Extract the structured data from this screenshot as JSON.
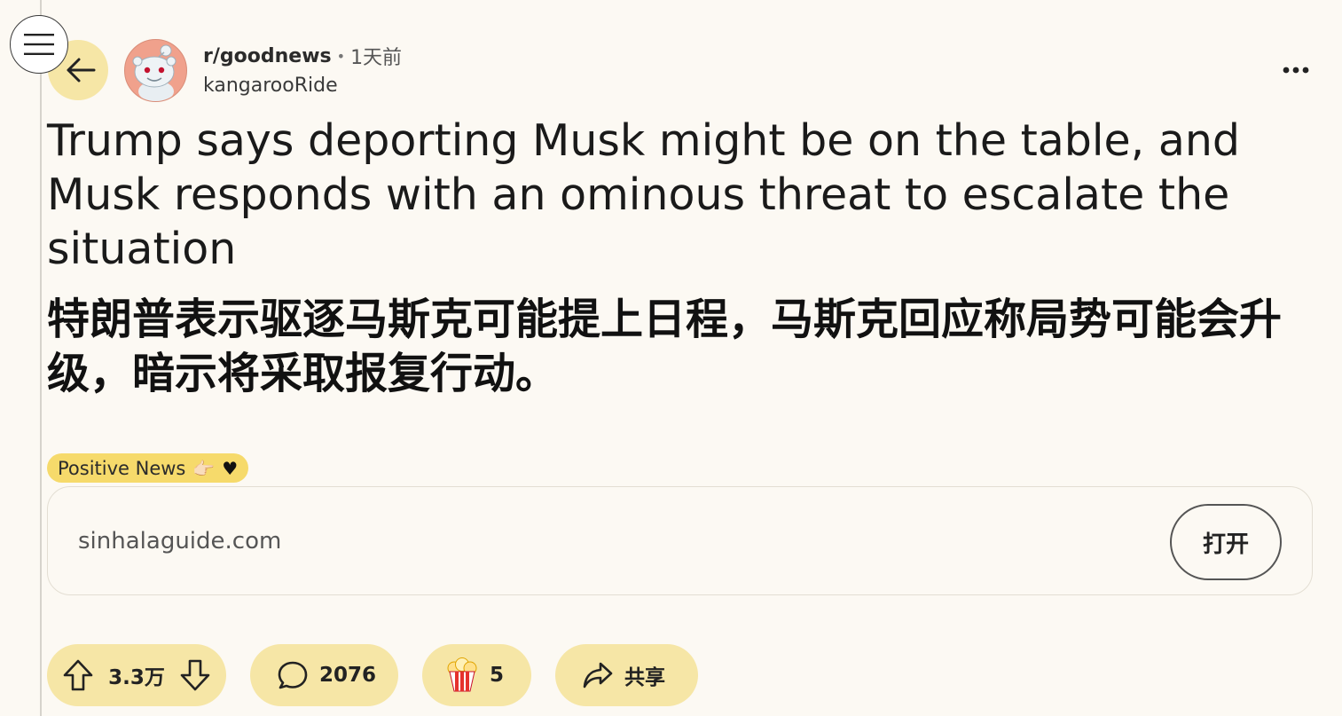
{
  "header": {
    "subreddit": "r/goodnews",
    "separator": "•",
    "time_ago": "1天前",
    "author": "kangarooRide"
  },
  "post": {
    "title_en": "Trump says deporting Musk might be on the table, and Musk responds with an ominous threat to escalate the situation",
    "title_zh": "特朗普表示驱逐马斯克可能提上日程，马斯克回应称局势可能会升级，暗示将采取报复行动。",
    "flair": {
      "text": "Positive News",
      "emoji": "👉🏻",
      "heart": "♥",
      "color": "#f6da6b"
    },
    "link": {
      "domain": "sinhalaguide.com",
      "open_label": "打开"
    }
  },
  "actions": {
    "votes": "3.3万",
    "comments": "2076",
    "awards": "5",
    "share_label": "共享"
  },
  "icons": {
    "menu": "hamburger-icon",
    "back": "arrow-left-icon",
    "more": "more-horizontal-icon",
    "upvote": "arrow-up-icon",
    "downvote": "arrow-down-icon",
    "comment": "comment-bubble-icon",
    "award": "popcorn-award-icon",
    "share": "share-arrow-icon"
  },
  "colors": {
    "background": "#fcf9f3",
    "pill": "#f6e6a6",
    "flair": "#f6da6b",
    "avatar": "#f0a18c"
  }
}
